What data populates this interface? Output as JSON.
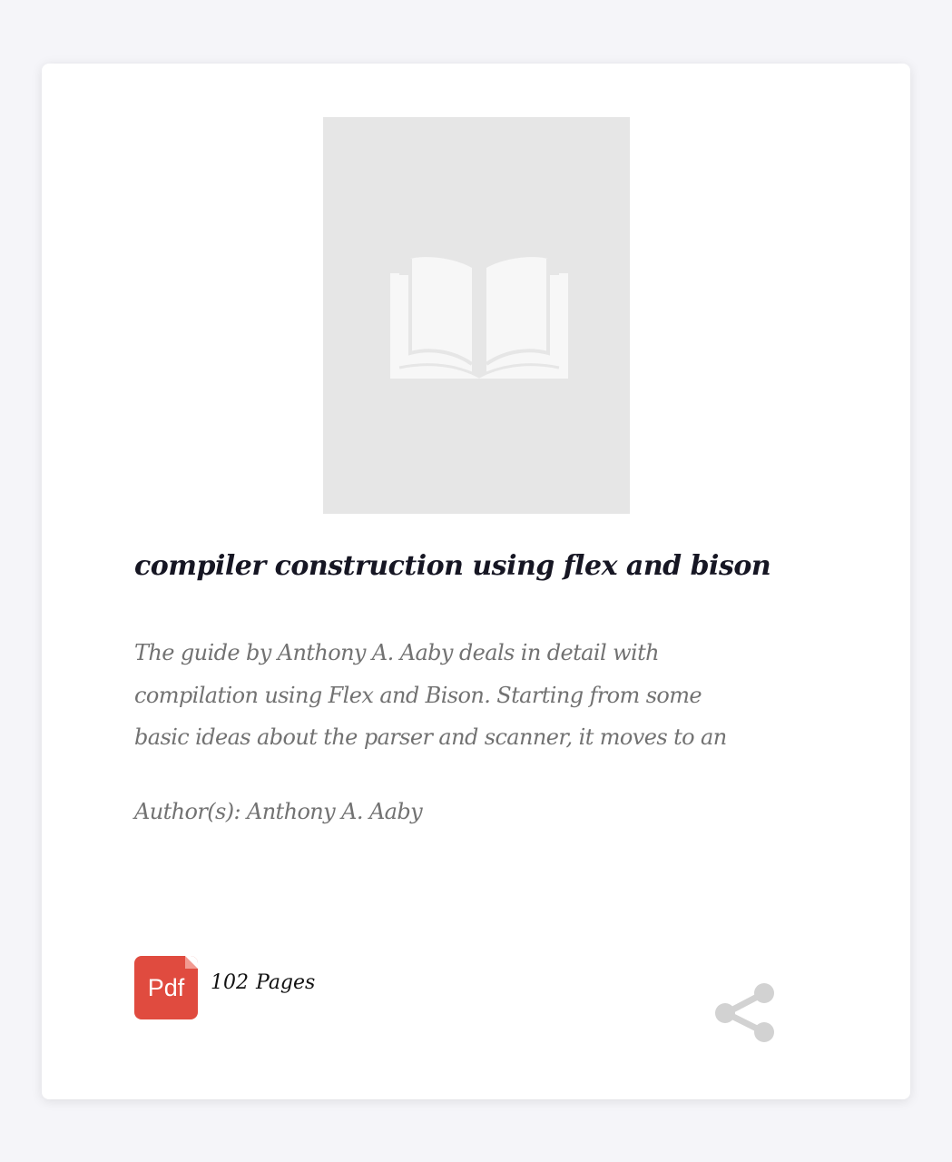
{
  "book": {
    "title": "compiler construction using flex and bison",
    "description": "The guide by Anthony A. Aaby deals in detail with compilation using Flex and Bison. Starting from some basic ideas about the parser and scanner, it moves to an",
    "author": "Author(s): Anthony A. Aaby",
    "format_label": "Pdf",
    "page_count": "102",
    "pages_label": "Pages"
  },
  "icons": {
    "cover_placeholder": "open-book-icon",
    "format": "pdf-icon",
    "share": "share-icon"
  },
  "colors": {
    "pdf_badge": "#e04b3f",
    "title": "#161623",
    "description": "#727272",
    "placeholder": "#e6e6e6",
    "share_icon": "#d2d2d2"
  }
}
